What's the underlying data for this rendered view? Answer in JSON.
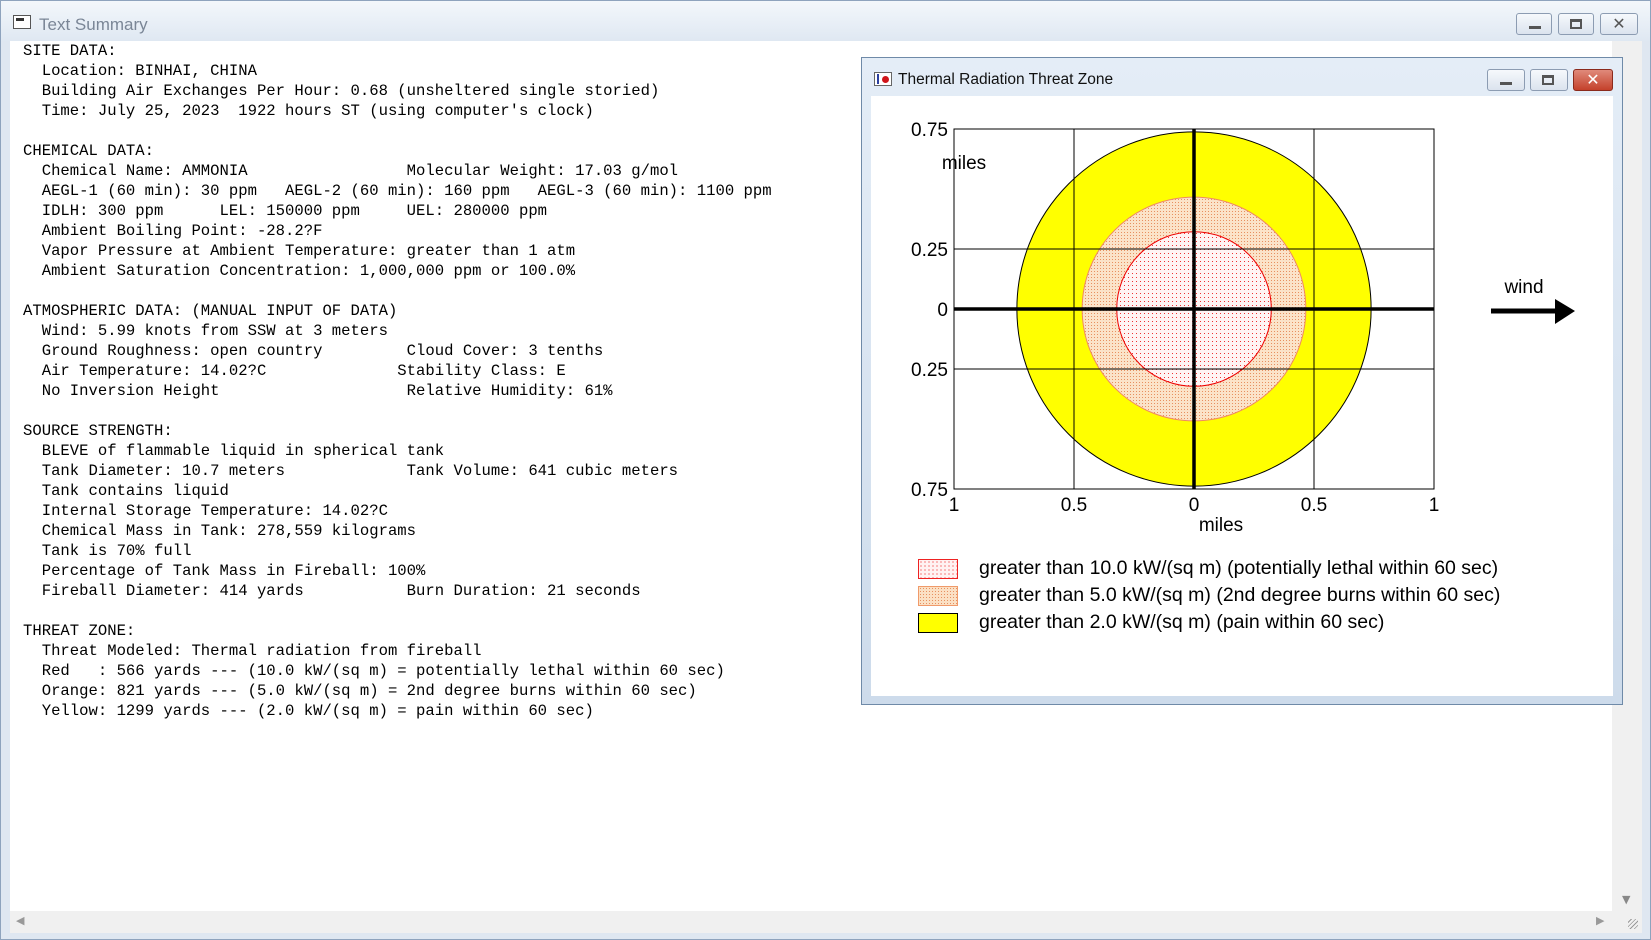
{
  "main_window": {
    "title": "Text Summary"
  },
  "summary_lines": [
    "SITE DATA:",
    "  Location: BINHAI, CHINA",
    "  Building Air Exchanges Per Hour: 0.68 (unsheltered single storied)",
    "  Time: July 25, 2023  1922 hours ST (using computer's clock)",
    "",
    "CHEMICAL DATA:",
    "  Chemical Name: AMMONIA                 Molecular Weight: 17.03 g/mol",
    "  AEGL-1 (60 min): 30 ppm   AEGL-2 (60 min): 160 ppm   AEGL-3 (60 min): 1100 ppm",
    "  IDLH: 300 ppm      LEL: 150000 ppm     UEL: 280000 ppm",
    "  Ambient Boiling Point: -28.2?F",
    "  Vapor Pressure at Ambient Temperature: greater than 1 atm",
    "  Ambient Saturation Concentration: 1,000,000 ppm or 100.0%",
    "",
    "ATMOSPHERIC DATA: (MANUAL INPUT OF DATA)",
    "  Wind: 5.99 knots from SSW at 3 meters",
    "  Ground Roughness: open country         Cloud Cover: 3 tenths",
    "  Air Temperature: 14.02?C              Stability Class: E",
    "  No Inversion Height                    Relative Humidity: 61%",
    "",
    "SOURCE STRENGTH:",
    "  BLEVE of flammable liquid in spherical tank",
    "  Tank Diameter: 10.7 meters             Tank Volume: 641 cubic meters",
    "  Tank contains liquid",
    "  Internal Storage Temperature: 14.02?C",
    "  Chemical Mass in Tank: 278,559 kilograms",
    "  Tank is 70% full",
    "  Percentage of Tank Mass in Fireball: 100%",
    "  Fireball Diameter: 414 yards           Burn Duration: 21 seconds",
    "",
    "THREAT ZONE:",
    "  Threat Modeled: Thermal radiation from fireball",
    "  Red   : 566 yards --- (10.0 kW/(sq m) = potentially lethal within 60 sec)",
    "  Orange: 821 yards --- (5.0 kW/(sq m) = 2nd degree burns within 60 sec)",
    "  Yellow: 1299 yards --- (2.0 kW/(sq m) = pain within 60 sec)"
  ],
  "threat_window": {
    "title": "Thermal Radiation Threat Zone",
    "wind_label": "wind",
    "legend": [
      {
        "text": "greater than 10.0 kW/(sq m) (potentially lethal within 60 sec)",
        "zone": "red"
      },
      {
        "text": "greater than 5.0 kW/(sq m) (2nd degree burns within 60 sec)",
        "zone": "orange"
      },
      {
        "text": "greater than 2.0 kW/(sq m) (pain within 60 sec)",
        "zone": "yellow"
      }
    ]
  },
  "chart_data": {
    "type": "scatter",
    "xlabel": "miles",
    "ylabel": "miles",
    "xlim": [
      -1,
      1
    ],
    "ylim": [
      -0.75,
      0.75
    ],
    "x_ticks": [
      -1,
      -0.5,
      0,
      0.5,
      1
    ],
    "x_tick_labels": [
      "1",
      "0.5",
      "0",
      "0.5",
      "1"
    ],
    "y_ticks": [
      0.75,
      0.25,
      0,
      -0.25,
      -0.75
    ],
    "y_tick_labels": [
      "0.75",
      "0.25",
      "0",
      "0.25",
      "0.75"
    ],
    "grid": true,
    "zones": [
      {
        "name": "Yellow",
        "radius_miles": 0.738,
        "fill": "#ffff00",
        "stroke": "#000000",
        "pattern": "solid"
      },
      {
        "name": "Orange",
        "radius_miles": 0.466,
        "fill": "#f9d8b8",
        "stroke": "#f08a60",
        "pattern": "dots-orange"
      },
      {
        "name": "Red",
        "radius_miles": 0.322,
        "fill": "#fff2f2",
        "stroke": "#ee0000",
        "pattern": "dots-red"
      }
    ],
    "colors": {
      "yellow": "#ffff00",
      "orange": "#f9d8b8",
      "red": "#ee0000"
    }
  }
}
